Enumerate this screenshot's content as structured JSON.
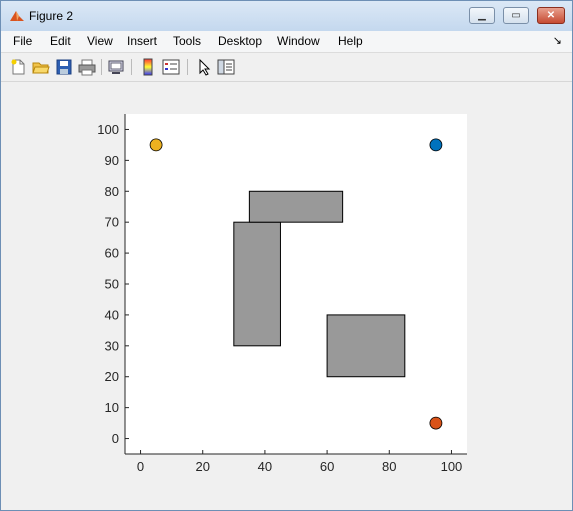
{
  "window": {
    "title": "Figure 2"
  },
  "menu": [
    "File",
    "Edit",
    "View",
    "Insert",
    "Tools",
    "Desktop",
    "Window",
    "Help"
  ],
  "toolbar_icons": [
    "new-figure-icon",
    "open-file-icon",
    "save-icon",
    "print-icon",
    "link-plot-icon",
    "colorbar-icon",
    "legend-icon",
    "pointer-icon",
    "property-editor-icon"
  ],
  "chart_data": {
    "type": "scatter",
    "xlim": [
      -5,
      105
    ],
    "ylim": [
      -5,
      105
    ],
    "xticks": [
      0,
      20,
      40,
      60,
      80,
      100
    ],
    "yticks": [
      0,
      10,
      20,
      30,
      40,
      50,
      60,
      70,
      80,
      90,
      100
    ],
    "obstacles": [
      {
        "x": 30,
        "y": 30,
        "w": 15,
        "h": 40,
        "color": "#999999"
      },
      {
        "x": 35,
        "y": 70,
        "w": 30,
        "h": 10,
        "color": "#999999"
      },
      {
        "x": 60,
        "y": 20,
        "w": 25,
        "h": 20,
        "color": "#999999"
      }
    ],
    "points": [
      {
        "x": 5,
        "y": 95,
        "color": "#EDB120"
      },
      {
        "x": 95,
        "y": 95,
        "color": "#0072BD"
      },
      {
        "x": 95,
        "y": 5,
        "color": "#D95319"
      }
    ]
  }
}
